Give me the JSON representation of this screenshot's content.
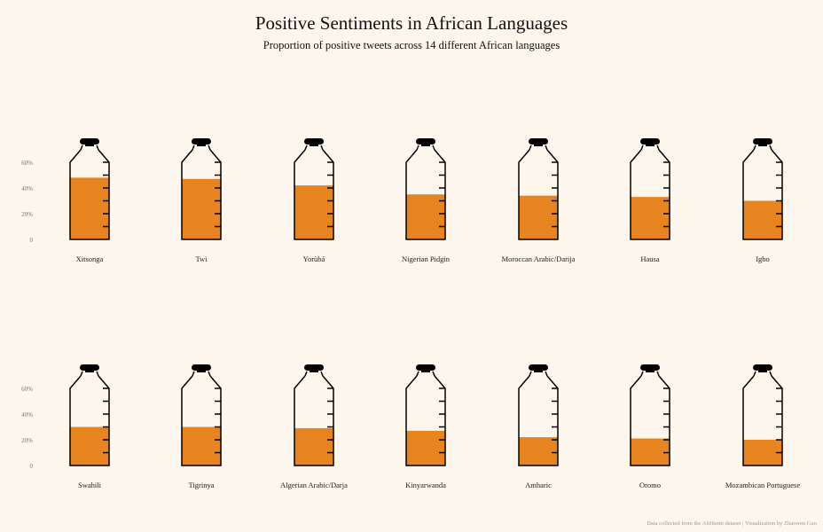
{
  "title": "Positive Sentiments in African Languages",
  "subtitle": "Proportion of positive tweets across 14 different African languages",
  "footer": "Data collected from the AfriSenti dataset | Visualization by Zhaowen Guo",
  "colors": {
    "background": "#fcf6ec",
    "fill": "#e8841f",
    "outline": "#000000",
    "tick_label": "#777777"
  },
  "chart_data": {
    "type": "bar",
    "style": "bottle",
    "ylim": [
      0,
      0.7
    ],
    "yticks": [
      0,
      0.2,
      0.4,
      0.6
    ],
    "yticklabels": [
      "0",
      "20%",
      "40%",
      "60%"
    ],
    "categories": [
      "Xitsonga",
      "Twi",
      "Yorùbá",
      "Nigerian Pidgin",
      "Moroccan Arabic/Darija",
      "Hausa",
      "Igbo",
      "Swahili",
      "Tigrinya",
      "Algerian Arabic/Darja",
      "Kinyarwanda",
      "Amharic",
      "Oromo",
      "Mozambican Portuguese"
    ],
    "values": [
      0.48,
      0.47,
      0.42,
      0.35,
      0.34,
      0.33,
      0.3,
      0.3,
      0.3,
      0.29,
      0.27,
      0.22,
      0.21,
      0.2
    ]
  }
}
